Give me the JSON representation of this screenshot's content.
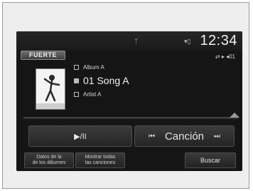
{
  "status_bar": {
    "clock": "12:34",
    "signal_icon": "antenna-icon",
    "phone_icon": "phone-signal-icon"
  },
  "source": {
    "label": "FUERTE"
  },
  "mode_icons": {
    "text": "⇄ ▸ ◂01"
  },
  "now_playing": {
    "album": "Album A",
    "track": "01 Song A",
    "artist": "Artist A"
  },
  "controls": {
    "play_pause_label": "▶/II",
    "track_label": "Canción",
    "skip_back": "⏮",
    "skip_forward": "⏭"
  },
  "soft_buttons": {
    "btn1_line1": "Datos de la",
    "btn1_line2": "de los álbumes",
    "btn2_line1": "Mostrar todas",
    "btn2_line2": "las canciones",
    "btn3": "Buscar"
  }
}
